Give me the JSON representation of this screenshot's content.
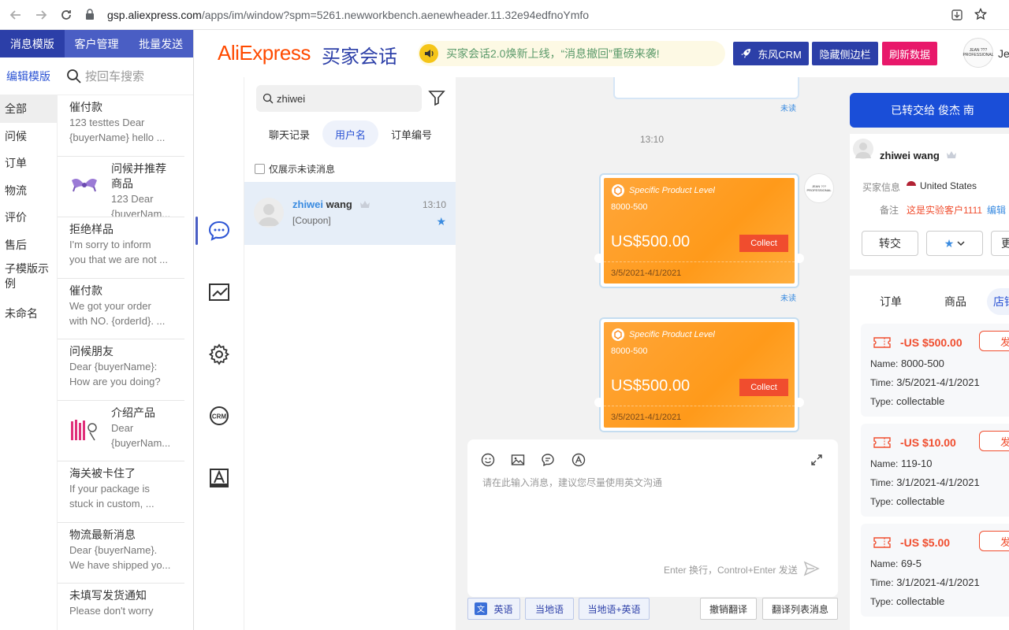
{
  "browser": {
    "url_domain": "gsp.aliexpress.com",
    "url_path": "/apps/im/window?spm=5261.newworkbench.aenewheader.11.32e94edfnoYmfo"
  },
  "left_panel": {
    "tabs": [
      "消息模版",
      "客户管理",
      "批量发送"
    ],
    "edit_label": "编辑模版",
    "search_placeholder": "按回车搜索",
    "categories": [
      "全部",
      "问候",
      "订单",
      "物流",
      "评价",
      "售后",
      "子模版示例",
      "未命名"
    ],
    "templates": [
      {
        "title": "催付款",
        "body1": "123  testtes Dear",
        "body2": "{buyerName} hello ..."
      },
      {
        "title": "问候并推荐商品",
        "body1": "123 Dear",
        "body2": "{buyerNam..."
      },
      {
        "title": "拒绝样品",
        "body1": "I'm sorry to inform",
        "body2": "you that we are not ..."
      },
      {
        "title": "催付款",
        "body1": "We got your order",
        "body2": "with NO. {orderId}. ..."
      },
      {
        "title": "问候朋友",
        "body1": "Dear {buyerName}:",
        "body2": "How are you doing?"
      },
      {
        "title": "介绍产品",
        "body1": "Dear",
        "body2": "{buyerNam..."
      },
      {
        "title": "海关被卡住了",
        "body1": "If your package is",
        "body2": "stuck in custom, ..."
      },
      {
        "title": "物流最新消息",
        "body1": "Dear {buyerName}.",
        "body2": "We have shipped yo..."
      },
      {
        "title": "未填写发货通知",
        "body1": "Please don't worry",
        "body2": ""
      }
    ]
  },
  "header": {
    "logo": "AliExpress",
    "logo_cn": "买家会话",
    "notice": "买家会话2.0焕新上线，“消息撤回”重磅来袭!",
    "btn_crm": "东风CRM",
    "btn_hide": "隐藏侧边栏",
    "btn_refresh": "刷新数据",
    "avatar_text": "JEAN ??? PROFESSIONAL",
    "user": "Je"
  },
  "conversations": {
    "search_value": "zhiwei",
    "tabs": [
      "聊天记录",
      "用户名",
      "订单编号"
    ],
    "unread_only": "仅展示未读消息",
    "items": [
      {
        "name_hl": "zhiwei",
        "name_rest": " wang",
        "time": "13:10",
        "message": "[Coupon]"
      }
    ]
  },
  "chat": {
    "unread": "未读",
    "time_sep": "13:10",
    "coupons": [
      {
        "level": "Specific Product Level",
        "name": "8000-500",
        "amount": "US$500.00",
        "collect": "Collect",
        "date": "3/5/2021-4/1/2021"
      },
      {
        "level": "Specific Product Level",
        "name": "8000-500",
        "amount": "US$500.00",
        "collect": "Collect",
        "date": "3/5/2021-4/1/2021"
      }
    ],
    "composer_placeholder": "请在此输入消息，建议您尽量使用英文沟通",
    "composer_hint": "Enter 换行，Control+Enter 发送",
    "translate_buttons": [
      "英语",
      "当地语",
      "当地语+英语",
      "撤销翻译",
      "翻译列表消息"
    ]
  },
  "right_panel": {
    "transferred": "已转交给 俊杰 南",
    "buyer_name": "zhiwei wang",
    "buyer_info_label": "买家信息",
    "buyer_country": "United States",
    "remark_label": "备注",
    "remark_value": "这是实验客户1111",
    "remark_edit": "编辑",
    "btn_transfer": "转交",
    "btn_star": "★",
    "btn_more": "更",
    "tabs": [
      "订单",
      "商品",
      "店铺"
    ],
    "coupons": [
      {
        "amount": "-US $500.00",
        "name_k": "Name:",
        "name": "8000-500",
        "time_k": "Time:",
        "time": "3/5/2021-4/1/2021",
        "type_k": "Type:",
        "type": "collectable",
        "send": "发送"
      },
      {
        "amount": "-US $10.00",
        "name_k": "Name:",
        "name": "119-10",
        "time_k": "Time:",
        "time": "3/1/2021-4/1/2021",
        "type_k": "Type:",
        "type": "collectable",
        "send": "发送"
      },
      {
        "amount": "-US $5.00",
        "name_k": "Name:",
        "name": "69-5",
        "time_k": "Time:",
        "time": "3/1/2021-4/1/2021",
        "type_k": "Type:",
        "type": "collectable",
        "send": "发送"
      }
    ]
  },
  "colors": {
    "brand_blue": "#2c3fa8",
    "accent_orange": "#ff4a00",
    "coupon_red": "#f04d2e",
    "refresh_pink": "#e8186a"
  }
}
